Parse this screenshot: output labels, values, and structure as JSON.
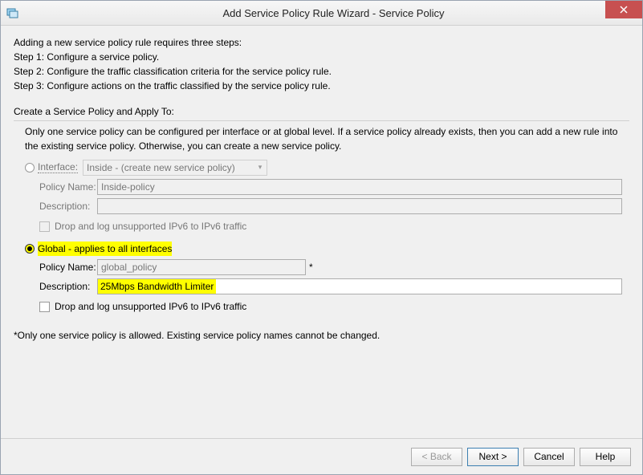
{
  "window": {
    "title": "Add Service Policy Rule Wizard - Service Policy"
  },
  "intro": {
    "heading": "Adding a new service policy rule requires three steps:",
    "step1": "Step 1:  Configure a service policy.",
    "step2": "Step 2:  Configure the traffic classification criteria for the service policy rule.",
    "step3": "Step 3:  Configure actions on the traffic classified by the service policy rule."
  },
  "apply_to": {
    "label": "Create a Service Policy and Apply To:",
    "note": "Only one service policy can be configured per interface or at global level. If a service policy already exists, then you can add a new rule into the existing service policy. Otherwise, you can create a new service policy."
  },
  "interface_group": {
    "radio_label": "Interface:",
    "combo_value": "Inside - (create new service policy)",
    "policy_name_label": "Policy Name:",
    "policy_name_value": "Inside-policy",
    "description_label": "Description:",
    "description_value": "",
    "drop_label": "Drop and log unsupported IPv6 to IPv6 traffic"
  },
  "global_group": {
    "radio_label": "Global - applies to all interfaces",
    "policy_name_label": "Policy Name:",
    "policy_name_value": "global_policy",
    "description_label": "Description:",
    "description_value": "25Mbps Bandwidth Limiter",
    "drop_label": "Drop and log unsupported IPv6 to IPv6 traffic"
  },
  "footnote": "*Only one service policy is allowed. Existing service policy names cannot be changed.",
  "buttons": {
    "back": "< Back",
    "next": "Next >",
    "cancel": "Cancel",
    "help": "Help"
  }
}
